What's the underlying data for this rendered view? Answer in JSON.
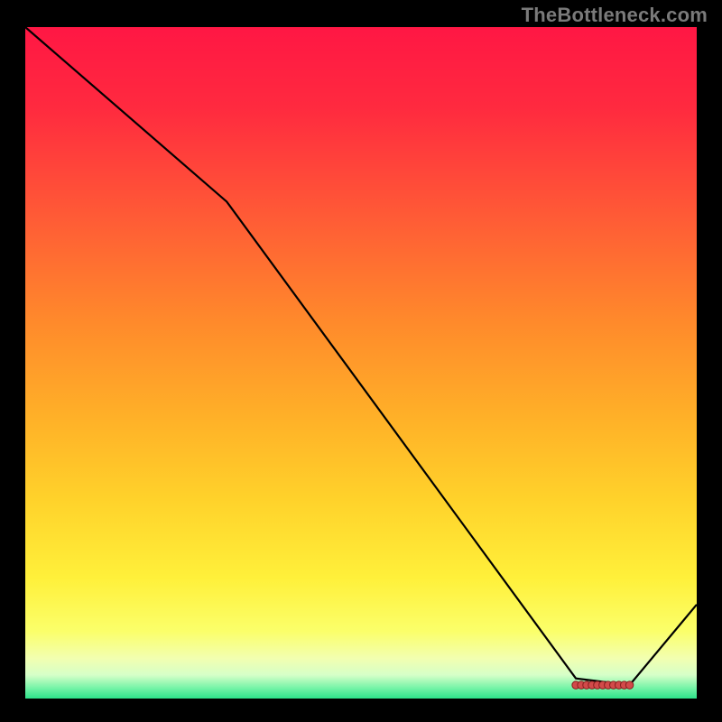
{
  "attribution": "TheBottleneck.com",
  "colors": {
    "bg": "#000000",
    "text_muted": "#7a7a7a",
    "curve": "#000000",
    "marker_fill": "#d24a4a",
    "marker_stroke": "#8a1f1f",
    "gradient_stops": [
      {
        "offset": 0.0,
        "color": "#ff1744"
      },
      {
        "offset": 0.12,
        "color": "#ff2a3f"
      },
      {
        "offset": 0.28,
        "color": "#ff5a36"
      },
      {
        "offset": 0.44,
        "color": "#ff8a2b"
      },
      {
        "offset": 0.58,
        "color": "#ffb028"
      },
      {
        "offset": 0.7,
        "color": "#ffd12a"
      },
      {
        "offset": 0.82,
        "color": "#fff03a"
      },
      {
        "offset": 0.9,
        "color": "#fbff6a"
      },
      {
        "offset": 0.94,
        "color": "#f2ffb0"
      },
      {
        "offset": 0.965,
        "color": "#d6ffc8"
      },
      {
        "offset": 0.985,
        "color": "#72f3a6"
      },
      {
        "offset": 1.0,
        "color": "#2de38a"
      }
    ]
  },
  "chart_data": {
    "type": "line",
    "title": "",
    "xlabel": "",
    "ylabel": "",
    "xlim": [
      0,
      100
    ],
    "ylim": [
      0,
      100
    ],
    "x": [
      0,
      30,
      82,
      90,
      100
    ],
    "series": [
      {
        "name": "curve",
        "values": [
          100,
          74,
          3,
          2,
          14
        ]
      }
    ],
    "markers": {
      "x_range": [
        82,
        90
      ],
      "y": 2,
      "count": 11
    }
  }
}
